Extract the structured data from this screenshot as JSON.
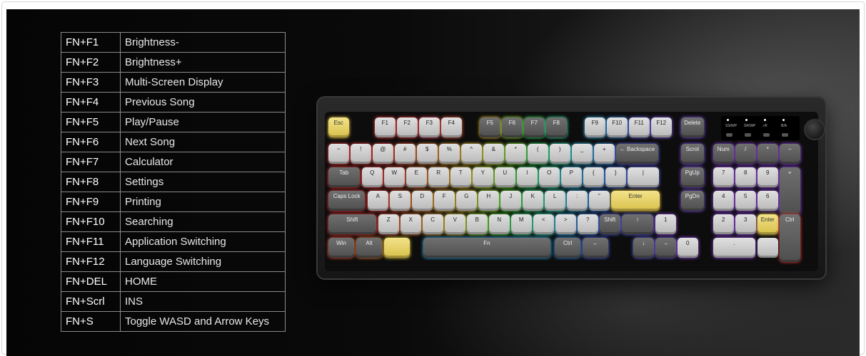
{
  "shortcuts": [
    {
      "combo": "FN+F1",
      "action": "Brightness-"
    },
    {
      "combo": "FN+F2",
      "action": "Brightness+"
    },
    {
      "combo": "FN+F3",
      "action": "Multi-Screen Display"
    },
    {
      "combo": "FN+F4",
      "action": "Previous Song"
    },
    {
      "combo": "FN+F5",
      "action": "Play/Pause"
    },
    {
      "combo": "FN+F6",
      "action": "Next Song"
    },
    {
      "combo": "FN+F7",
      "action": "Calculator"
    },
    {
      "combo": "FN+F8",
      "action": "Settings"
    },
    {
      "combo": "FN+F9",
      "action": "Printing"
    },
    {
      "combo": "FN+F10",
      "action": "Searching"
    },
    {
      "combo": "FN+F11",
      "action": "Application Switching"
    },
    {
      "combo": "FN+F12",
      "action": "Language Switching"
    },
    {
      "combo": "FN+DEL",
      "action": "HOME"
    },
    {
      "combo": "FN+Scrl",
      "action": "INS"
    },
    {
      "combo": "FN+S",
      "action": "Toggle WASD and Arrow Keys"
    }
  ],
  "keyboard": {
    "keys": [
      {
        "label": "Esc",
        "style": "yellow",
        "glow": "#ffd34d"
      },
      {
        "label": "F1",
        "style": "light",
        "glow": "#ff3b3b"
      },
      {
        "label": "F2",
        "style": "light",
        "glow": "#ff3b3b"
      },
      {
        "label": "F3",
        "style": "light",
        "glow": "#ff4b6b"
      },
      {
        "label": "F4",
        "style": "light",
        "glow": "#ff6a3b"
      },
      {
        "label": "F5",
        "style": "dark",
        "glow": "#ffd23b"
      },
      {
        "label": "F6",
        "style": "dark",
        "glow": "#a6ff3b"
      },
      {
        "label": "F7",
        "style": "dark",
        "glow": "#3bff6a"
      },
      {
        "label": "F8",
        "style": "dark",
        "glow": "#3bffb0"
      },
      {
        "label": "F9",
        "style": "light",
        "glow": "#3bc0ff"
      },
      {
        "label": "F10",
        "style": "light",
        "glow": "#3b9cff"
      },
      {
        "label": "F11",
        "style": "light",
        "glow": "#6a6aff"
      },
      {
        "label": "F12",
        "style": "light",
        "glow": "#8a5bff"
      },
      {
        "label": "Delete",
        "style": "dark",
        "glow": "#8a5bff"
      },
      {
        "label": "~",
        "style": "light",
        "glow": "#ff3b3b"
      },
      {
        "label": "!",
        "style": "light",
        "glow": "#ff3b3b"
      },
      {
        "label": "@",
        "style": "light",
        "glow": "#ff3b3b"
      },
      {
        "label": "#",
        "style": "light",
        "glow": "#ff5a3b"
      },
      {
        "label": "$",
        "style": "light",
        "glow": "#ff8a3b"
      },
      {
        "label": "%",
        "style": "light",
        "glow": "#ffb03b"
      },
      {
        "label": "^",
        "style": "light",
        "glow": "#ffd23b"
      },
      {
        "label": "&",
        "style": "light",
        "glow": "#e0ff3b"
      },
      {
        "label": "*",
        "style": "light",
        "glow": "#8aff3b"
      },
      {
        "label": "(",
        "style": "light",
        "glow": "#3bff6a"
      },
      {
        "label": ")",
        "style": "light",
        "glow": "#3bffc0"
      },
      {
        "label": "_",
        "style": "light",
        "glow": "#3bd0ff"
      },
      {
        "label": "+",
        "style": "light",
        "glow": "#3b9cff"
      },
      {
        "label": "← Backspace",
        "style": "dark",
        "glow": "#6a6aff"
      },
      {
        "label": "Scrol",
        "style": "dark",
        "glow": "#8a5bff"
      },
      {
        "label": "Num",
        "style": "dark",
        "glow": "#a04bff"
      },
      {
        "label": "/",
        "style": "dark",
        "glow": "#a04bff"
      },
      {
        "label": "*",
        "style": "dark",
        "glow": "#a04bff"
      },
      {
        "label": "−",
        "style": "dark",
        "glow": "#a04bff"
      },
      {
        "label": "Tab",
        "style": "dark",
        "glow": "#ff3b3b"
      },
      {
        "label": "Q",
        "style": "light",
        "glow": "#ff3b3b"
      },
      {
        "label": "W",
        "style": "light",
        "glow": "#ff4b3b"
      },
      {
        "label": "E",
        "style": "light",
        "glow": "#ff7a3b"
      },
      {
        "label": "R",
        "style": "light",
        "glow": "#ffa03b"
      },
      {
        "label": "T",
        "style": "light",
        "glow": "#ffd23b"
      },
      {
        "label": "Y",
        "style": "light",
        "glow": "#e0ff3b"
      },
      {
        "label": "U",
        "style": "light",
        "glow": "#8aff3b"
      },
      {
        "label": "I",
        "style": "light",
        "glow": "#3bff6a"
      },
      {
        "label": "O",
        "style": "light",
        "glow": "#3bffc0"
      },
      {
        "label": "P",
        "style": "light",
        "glow": "#3bd0ff"
      },
      {
        "label": "{",
        "style": "light",
        "glow": "#3b9cff"
      },
      {
        "label": "}",
        "style": "light",
        "glow": "#3b7aff"
      },
      {
        "label": "|",
        "style": "light",
        "glow": "#6a6aff"
      },
      {
        "label": "PgUp",
        "style": "dark",
        "glow": "#8a5bff"
      },
      {
        "label": "7",
        "style": "light",
        "glow": "#a04bff"
      },
      {
        "label": "8",
        "style": "light",
        "glow": "#a04bff"
      },
      {
        "label": "9",
        "style": "light",
        "glow": "#a04bff"
      },
      {
        "label": "+",
        "style": "dark",
        "glow": "#a04bff"
      },
      {
        "label": "Caps Lock",
        "style": "dark",
        "glow": "#ff3b3b"
      },
      {
        "label": "A",
        "style": "light",
        "glow": "#ff3b3b"
      },
      {
        "label": "S",
        "style": "light",
        "glow": "#ff6a3b"
      },
      {
        "label": "D",
        "style": "light",
        "glow": "#ff903b"
      },
      {
        "label": "F",
        "style": "light",
        "glow": "#ffc03b"
      },
      {
        "label": "G",
        "style": "light",
        "glow": "#ffe03b"
      },
      {
        "label": "H",
        "style": "light",
        "glow": "#b0ff3b"
      },
      {
        "label": "J",
        "style": "light",
        "glow": "#5aff3b"
      },
      {
        "label": "K",
        "style": "light",
        "glow": "#3bff8a"
      },
      {
        "label": "L",
        "style": "light",
        "glow": "#3bffd0"
      },
      {
        "label": ":",
        "style": "light",
        "glow": "#3bc0ff"
      },
      {
        "label": "\"",
        "style": "light",
        "glow": "#3b8aff"
      },
      {
        "label": "Enter",
        "style": "yellow",
        "glow": "#ffd34d"
      },
      {
        "label": "PgDn",
        "style": "dark",
        "glow": "#8a5bff"
      },
      {
        "label": "4",
        "style": "light",
        "glow": "#a04bff"
      },
      {
        "label": "5",
        "style": "light",
        "glow": "#a04bff"
      },
      {
        "label": "6",
        "style": "light",
        "glow": "#a04bff"
      },
      {
        "label": "Shift",
        "style": "dark",
        "glow": "#ff3b3b"
      },
      {
        "label": "Z",
        "style": "light",
        "glow": "#ff5a3b"
      },
      {
        "label": "X",
        "style": "light",
        "glow": "#ff8a3b"
      },
      {
        "label": "C",
        "style": "light",
        "glow": "#ffb03b"
      },
      {
        "label": "V",
        "style": "light",
        "glow": "#ffe03b"
      },
      {
        "label": "B",
        "style": "light",
        "glow": "#b0ff3b"
      },
      {
        "label": "N",
        "style": "light",
        "glow": "#5aff3b"
      },
      {
        "label": "M",
        "style": "light",
        "glow": "#3bff8a"
      },
      {
        "label": "<",
        "style": "light",
        "glow": "#3bffd0"
      },
      {
        "label": ">",
        "style": "light",
        "glow": "#3bc0ff"
      },
      {
        "label": "?",
        "style": "light",
        "glow": "#3b8aff"
      },
      {
        "label": "Shift",
        "style": "dark",
        "glow": "#5a6aff"
      },
      {
        "label": "↑",
        "style": "dark",
        "glow": "#6a6aff"
      },
      {
        "label": "1",
        "style": "light",
        "glow": "#a04bff"
      },
      {
        "label": "2",
        "style": "light",
        "glow": "#a04bff"
      },
      {
        "label": "3",
        "style": "light",
        "glow": "#a04bff"
      },
      {
        "label": "Enter",
        "style": "yellow",
        "glow": "#ffd34d"
      },
      {
        "label": "Ctrl",
        "style": "dark",
        "glow": "#ff3b3b"
      },
      {
        "label": "Win",
        "style": "dark",
        "glow": "#ff5a3b"
      },
      {
        "label": "Alt",
        "style": "dark",
        "glow": "#ff8a3b"
      },
      {
        "label": "",
        "style": "yellow",
        "glow": "#ffe03b"
      },
      {
        "label": "Fn",
        "style": "dark",
        "glow": "#3bc0ff"
      },
      {
        "label": "Ctrl",
        "style": "dark",
        "glow": "#3b9cff"
      },
      {
        "label": "←",
        "style": "dark",
        "glow": "#5a6aff"
      },
      {
        "label": "↓",
        "style": "dark",
        "glow": "#6a6aff"
      },
      {
        "label": "→",
        "style": "dark",
        "glow": "#7a5bff"
      },
      {
        "label": "0",
        "style": "light",
        "glow": "#a04bff"
      },
      {
        "label": ".",
        "style": "light",
        "glow": "#a04bff"
      }
    ],
    "screen_labels": [
      "SS/WP",
      "SR/WP",
      "♪/II",
      "B/A"
    ]
  }
}
